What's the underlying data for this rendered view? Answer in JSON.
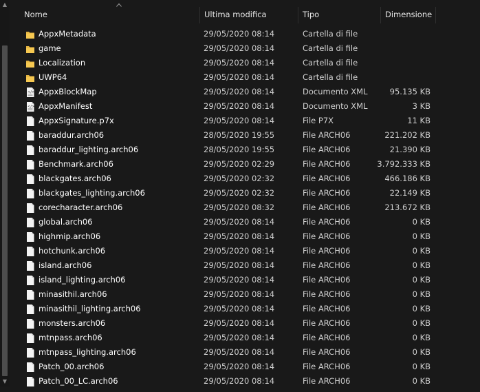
{
  "columns": {
    "name": "Nome",
    "modified": "Ultima modifica",
    "type": "Tipo",
    "size": "Dimensione"
  },
  "files": [
    {
      "name": "AppxMetadata",
      "date": "29/05/2020 08:14",
      "type": "Cartella di file",
      "size": "",
      "icon": "folder-icon"
    },
    {
      "name": "game",
      "date": "29/05/2020 08:14",
      "type": "Cartella di file",
      "size": "",
      "icon": "folder-icon"
    },
    {
      "name": "Localization",
      "date": "29/05/2020 08:14",
      "type": "Cartella di file",
      "size": "",
      "icon": "folder-icon"
    },
    {
      "name": "UWP64",
      "date": "29/05/2020 08:14",
      "type": "Cartella di file",
      "size": "",
      "icon": "folder-icon"
    },
    {
      "name": "AppxBlockMap",
      "date": "29/05/2020 08:14",
      "type": "Documento XML",
      "size": "95.135 KB",
      "icon": "xml-file-icon"
    },
    {
      "name": "AppxManifest",
      "date": "29/05/2020 08:14",
      "type": "Documento XML",
      "size": "3 KB",
      "icon": "xml-file-icon"
    },
    {
      "name": "AppxSignature.p7x",
      "date": "29/05/2020 08:14",
      "type": "File P7X",
      "size": "11 KB",
      "icon": "file-icon"
    },
    {
      "name": "baraddur.arch06",
      "date": "28/05/2020 19:55",
      "type": "File ARCH06",
      "size": "221.202 KB",
      "icon": "file-icon"
    },
    {
      "name": "baraddur_lighting.arch06",
      "date": "28/05/2020 19:55",
      "type": "File ARCH06",
      "size": "21.390 KB",
      "icon": "file-icon"
    },
    {
      "name": "Benchmark.arch06",
      "date": "29/05/2020 02:29",
      "type": "File ARCH06",
      "size": "3.792.333 KB",
      "icon": "file-icon"
    },
    {
      "name": "blackgates.arch06",
      "date": "29/05/2020 02:32",
      "type": "File ARCH06",
      "size": "466.186 KB",
      "icon": "file-icon"
    },
    {
      "name": "blackgates_lighting.arch06",
      "date": "29/05/2020 02:32",
      "type": "File ARCH06",
      "size": "22.149 KB",
      "icon": "file-icon"
    },
    {
      "name": "corecharacter.arch06",
      "date": "29/05/2020 08:32",
      "type": "File ARCH06",
      "size": "213.672 KB",
      "icon": "file-icon"
    },
    {
      "name": "global.arch06",
      "date": "29/05/2020 08:14",
      "type": "File ARCH06",
      "size": "0 KB",
      "icon": "file-icon"
    },
    {
      "name": "highmip.arch06",
      "date": "29/05/2020 08:14",
      "type": "File ARCH06",
      "size": "0 KB",
      "icon": "file-icon"
    },
    {
      "name": "hotchunk.arch06",
      "date": "29/05/2020 08:14",
      "type": "File ARCH06",
      "size": "0 KB",
      "icon": "file-icon"
    },
    {
      "name": "island.arch06",
      "date": "29/05/2020 08:14",
      "type": "File ARCH06",
      "size": "0 KB",
      "icon": "file-icon"
    },
    {
      "name": "island_lighting.arch06",
      "date": "29/05/2020 08:14",
      "type": "File ARCH06",
      "size": "0 KB",
      "icon": "file-icon"
    },
    {
      "name": "minasithil.arch06",
      "date": "29/05/2020 08:14",
      "type": "File ARCH06",
      "size": "0 KB",
      "icon": "file-icon"
    },
    {
      "name": "minasithil_lighting.arch06",
      "date": "29/05/2020 08:14",
      "type": "File ARCH06",
      "size": "0 KB",
      "icon": "file-icon"
    },
    {
      "name": "monsters.arch06",
      "date": "29/05/2020 08:14",
      "type": "File ARCH06",
      "size": "0 KB",
      "icon": "file-icon"
    },
    {
      "name": "mtnpass.arch06",
      "date": "29/05/2020 08:14",
      "type": "File ARCH06",
      "size": "0 KB",
      "icon": "file-icon"
    },
    {
      "name": "mtnpass_lighting.arch06",
      "date": "29/05/2020 08:14",
      "type": "File ARCH06",
      "size": "0 KB",
      "icon": "file-icon"
    },
    {
      "name": "Patch_00.arch06",
      "date": "29/05/2020 08:14",
      "type": "File ARCH06",
      "size": "0 KB",
      "icon": "file-icon"
    },
    {
      "name": "Patch_00_LC.arch06",
      "date": "29/05/2020 08:14",
      "type": "File ARCH06",
      "size": "0 KB",
      "icon": "file-icon"
    }
  ]
}
